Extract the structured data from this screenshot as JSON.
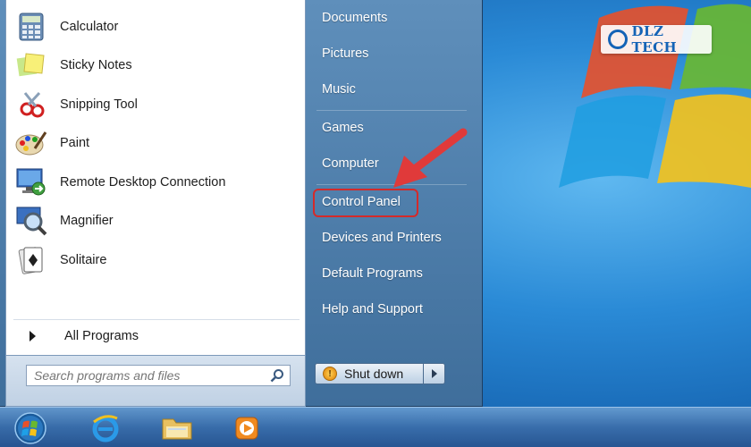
{
  "start_menu": {
    "programs": [
      {
        "label": "Calculator",
        "icon": "calculator-icon"
      },
      {
        "label": "Sticky Notes",
        "icon": "sticky-notes-icon"
      },
      {
        "label": "Snipping Tool",
        "icon": "snipping-tool-icon"
      },
      {
        "label": "Paint",
        "icon": "paint-icon"
      },
      {
        "label": "Remote Desktop Connection",
        "icon": "remote-desktop-icon"
      },
      {
        "label": "Magnifier",
        "icon": "magnifier-icon"
      },
      {
        "label": "Solitaire",
        "icon": "solitaire-icon"
      }
    ],
    "all_programs_label": "All Programs",
    "search": {
      "placeholder": "Search programs and files"
    },
    "right_items": [
      {
        "label": "Documents"
      },
      {
        "label": "Pictures"
      },
      {
        "label": "Music"
      },
      {
        "label": "Games"
      },
      {
        "label": "Computer"
      },
      {
        "label": "Control Panel",
        "highlighted": true
      },
      {
        "label": "Devices and Printers"
      },
      {
        "label": "Default Programs"
      },
      {
        "label": "Help and Support"
      }
    ],
    "shutdown_label": "Shut down"
  },
  "watermark": {
    "text": "DLZ TECH"
  },
  "taskbar": {
    "items": [
      {
        "icon": "start-orb-icon"
      },
      {
        "icon": "internet-explorer-icon"
      },
      {
        "icon": "file-explorer-icon"
      },
      {
        "icon": "media-player-icon"
      }
    ]
  },
  "colors": {
    "highlight": "#d42a2a",
    "menu_bg": "#4f7fab",
    "desktop": "#2a8ad6"
  }
}
